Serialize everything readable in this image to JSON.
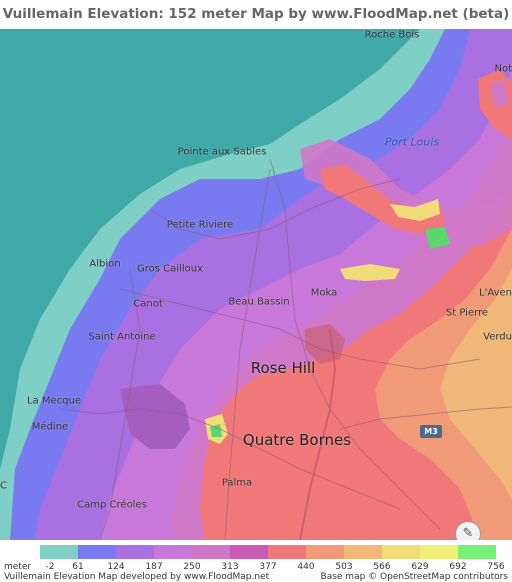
{
  "title": "Vuillemain Elevation: 152 meter Map by www.FloodMap.net (beta)",
  "places": {
    "roche_bois": "Roche Bois",
    "notre": "Not",
    "port_louis": "Port Louis",
    "pointe_aux_sables": "Pointe aux Sables",
    "petite_riviere": "Petite Riviere",
    "albion": "Albion",
    "gros_cailloux": "Gros Cailloux",
    "canot": "Canot",
    "beau_bassin": "Beau Bassin",
    "moka": "Moka",
    "l_aven": "L'Aven",
    "st_pierre": "St Pierre",
    "verdun": "Verdu",
    "saint_antoine": "Saint Antoine",
    "rose_hill": "Rose Hill",
    "la_mecque": "La Mecque",
    "medine": "Médine",
    "quatre_bornes": "Quatre Bornes",
    "palma": "Palma",
    "camp_creoles": "Camp Créoles",
    "edge_c": "C"
  },
  "road_badge": "M3",
  "legend": {
    "unit": "meter",
    "labels": [
      "-2",
      "61",
      "124",
      "187",
      "250",
      "313",
      "377",
      "440",
      "503",
      "566",
      "629",
      "692",
      "756"
    ],
    "colors": [
      "#7ecfc6",
      "#7a7af0",
      "#a870e0",
      "#c878d8",
      "#d078c8",
      "#c85ab8",
      "#f07878",
      "#f09a78",
      "#f0b878",
      "#f0dc78",
      "#f0f078",
      "#78f078",
      "#5ad86e"
    ]
  },
  "footer_left": "Vuillemain Elevation Map developed by www.FloodMap.net",
  "footer_right": "Base map © OpenStreetMap contributors"
}
